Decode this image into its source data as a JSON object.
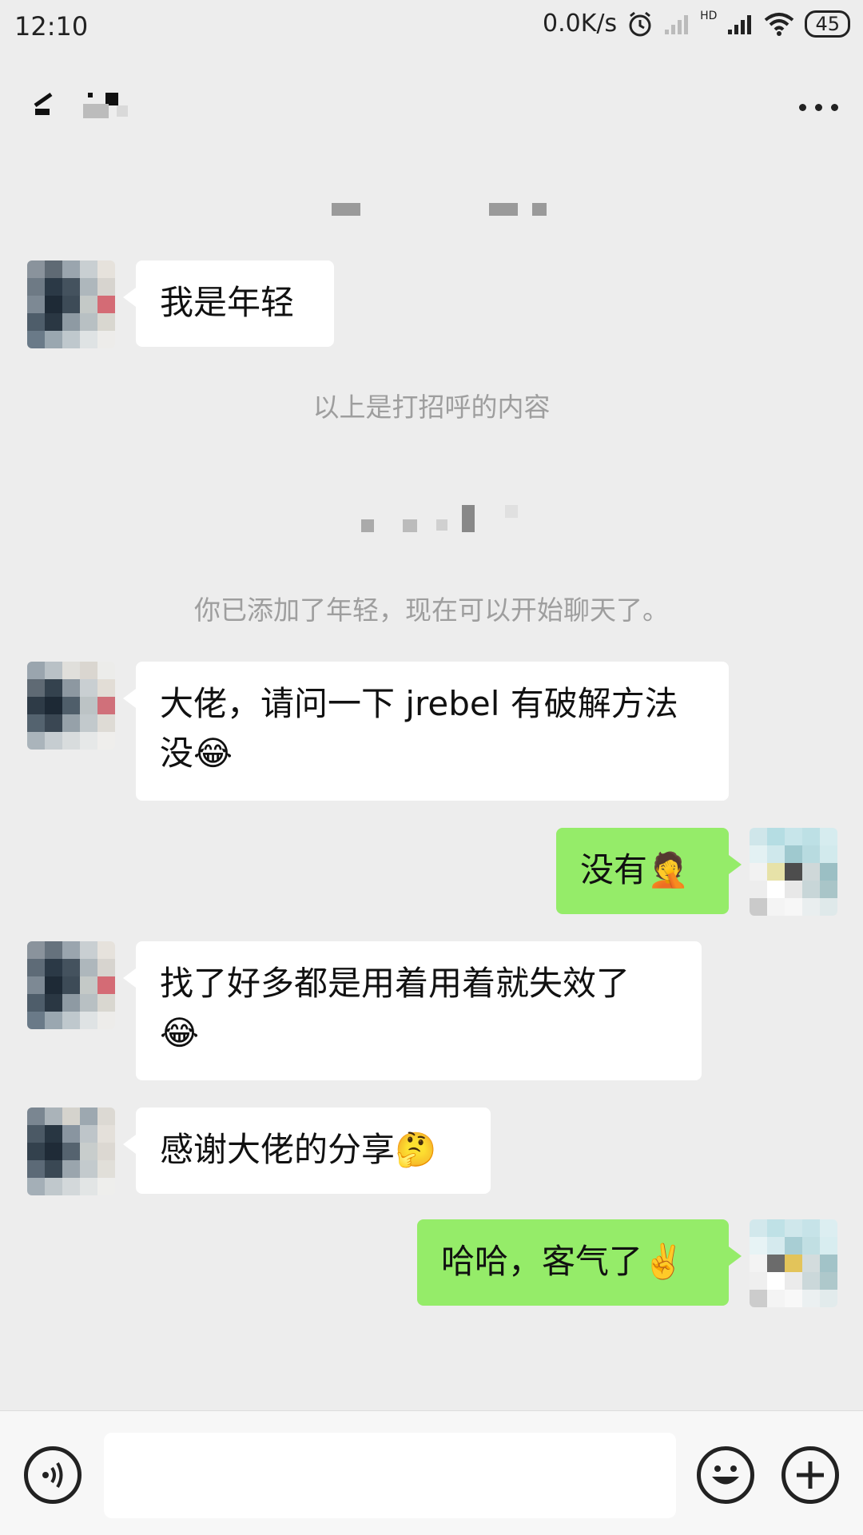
{
  "status_bar": {
    "time": "12:10",
    "network_speed": "0.0K/s",
    "hd_label": "HD",
    "battery": "45",
    "icons": [
      "alarm-icon",
      "signal-weak-icon",
      "signal-strong-icon",
      "wifi-icon",
      "battery-icon"
    ]
  },
  "header": {
    "back_icon": "back-arrow-icon",
    "more_icon": "more-dots-icon"
  },
  "messages": {
    "m1": "我是年轻",
    "sys1": "以上是打招呼的内容",
    "sys2": "你已添加了年轻，现在可以开始聊天了。",
    "m2_line1": "大佬，请问一下 jrebel 有破解方法",
    "m2_line2": "没😂",
    "m3": "没有🤦",
    "m4_line1": "找了好多都是用着用着就失效了",
    "m4_line2": "😂",
    "m5": "感谢大佬的分享🤔",
    "m6": "哈哈，客气了✌️"
  },
  "input_bar": {
    "voice_icon": "voice-icon",
    "emoji_icon": "emoji-icon",
    "plus_icon": "plus-icon"
  },
  "colors": {
    "background": "#ededed",
    "incoming_bubble": "#ffffff",
    "outgoing_bubble": "#95ec69",
    "system_text": "#9e9e9e"
  }
}
